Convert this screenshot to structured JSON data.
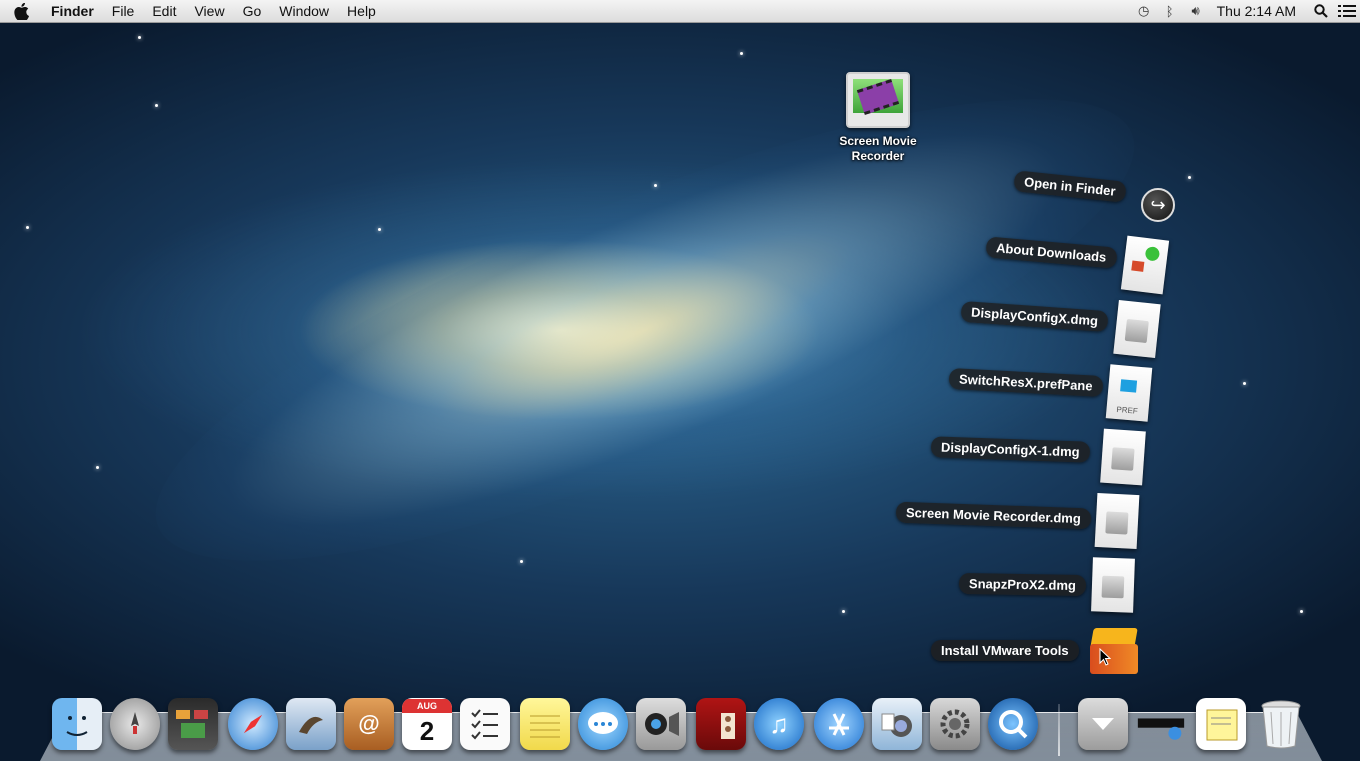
{
  "menubar": {
    "app_name": "Finder",
    "menus": [
      "File",
      "Edit",
      "View",
      "Go",
      "Window",
      "Help"
    ],
    "clock": "Thu 2:14 AM",
    "status_icons": [
      "time-machine-icon",
      "bluetooth-icon",
      "volume-icon",
      "spotlight-icon",
      "notification-center-icon"
    ]
  },
  "desktop": {
    "icon_label_line1": "Screen Movie",
    "icon_label_line2": "Recorder"
  },
  "stack": {
    "open_in_finder": "Open in Finder",
    "items": [
      "About Downloads",
      "DisplayConfigX.dmg",
      "SwitchResX.prefPane",
      "DisplayConfigX-1.dmg",
      "Screen Movie Recorder.dmg",
      "SnapzProX2.dmg",
      "Install VMware Tools"
    ],
    "pref_badge": "PREF"
  },
  "dock": {
    "apps": [
      "finder-icon",
      "launchpad-icon",
      "mission-control-icon",
      "safari-icon",
      "mail-icon",
      "contacts-icon",
      "calendar-icon",
      "reminders-icon",
      "notes-icon",
      "messages-icon",
      "facetime-icon",
      "photo-booth-icon",
      "itunes-icon",
      "app-store-icon",
      "preview-icon",
      "system-preferences-icon",
      "quicktime-icon"
    ],
    "calendar_day": "2",
    "calendar_month": "AUG"
  }
}
